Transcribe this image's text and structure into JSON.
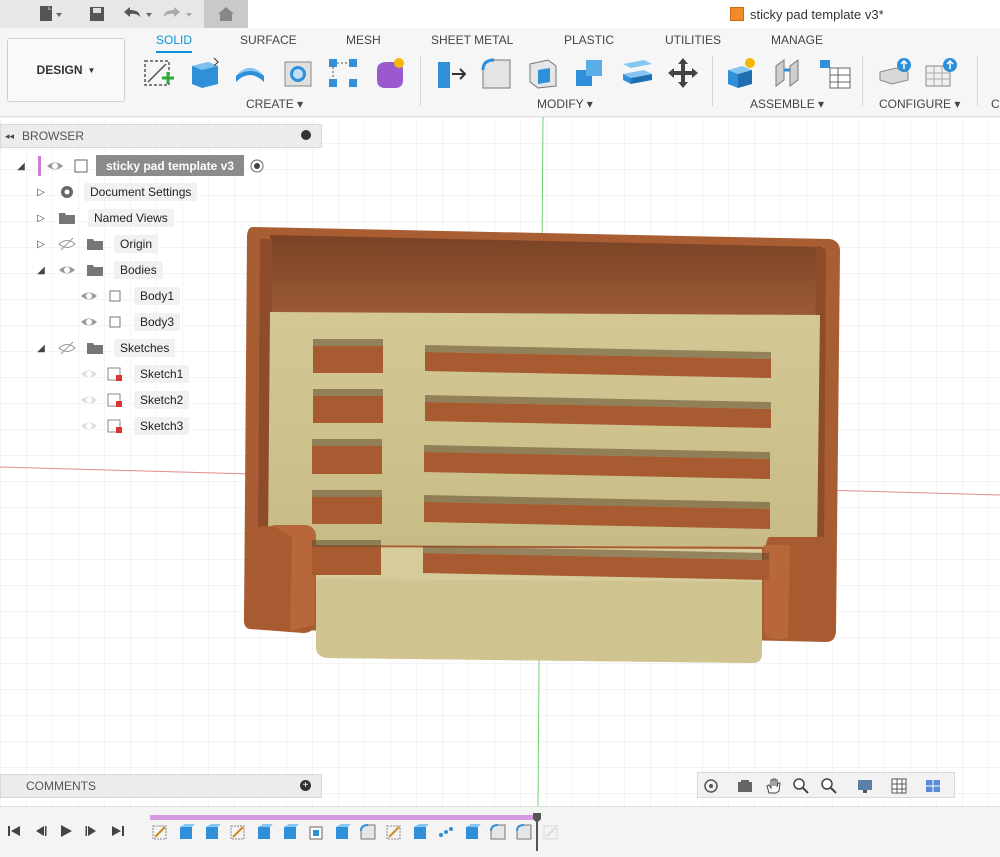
{
  "title_bar": {
    "document_title": "sticky pad template v3*",
    "icons": [
      "file-icon",
      "save-icon",
      "undo-icon",
      "redo-icon",
      "home-icon"
    ]
  },
  "workspace": {
    "label": "DESIGN"
  },
  "tabs": [
    {
      "label": "SOLID",
      "active": true
    },
    {
      "label": "SURFACE",
      "active": false
    },
    {
      "label": "MESH",
      "active": false
    },
    {
      "label": "SHEET METAL",
      "active": false
    },
    {
      "label": "PLASTIC",
      "active": false
    },
    {
      "label": "UTILITIES",
      "active": false
    },
    {
      "label": "MANAGE",
      "active": false
    }
  ],
  "tool_groups": [
    {
      "label": "CREATE"
    },
    {
      "label": "MODIFY"
    },
    {
      "label": "ASSEMBLE"
    },
    {
      "label": "CONFIGURE"
    },
    {
      "label": "C"
    }
  ],
  "browser": {
    "header": "BROWSER",
    "root": "sticky pad template v3",
    "items": [
      {
        "label": "Document Settings"
      },
      {
        "label": "Named Views"
      },
      {
        "label": "Origin"
      },
      {
        "label": "Bodies"
      },
      {
        "label": "Body1"
      },
      {
        "label": "Body3"
      },
      {
        "label": "Sketches"
      },
      {
        "label": "Sketch1"
      },
      {
        "label": "Sketch2"
      },
      {
        "label": "Sketch3"
      }
    ]
  },
  "comments": {
    "label": "COMMENTS"
  },
  "colors": {
    "accent": "#0696d7",
    "wood": "#a85a30",
    "sand": "#d9cf9e",
    "grid": "#dedede",
    "axis_red": "#e06666",
    "axis_green": "#44bb44"
  }
}
